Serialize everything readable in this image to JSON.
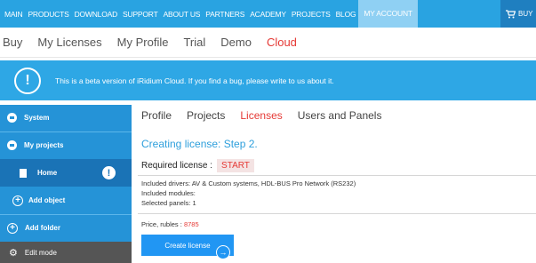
{
  "topnav": {
    "items": [
      "MAIN",
      "PRODUCTS",
      "DOWNLOAD",
      "SUPPORT",
      "ABOUT US",
      "PARTNERS",
      "ACADEMY",
      "PROJECTS",
      "BLOG"
    ],
    "active_item": "MY ACCOUNT",
    "cart_label": "BUY"
  },
  "subnav": {
    "items": [
      "Buy",
      "My Licenses",
      "My Profile",
      "Trial",
      "Demo"
    ],
    "active_item": "Cloud"
  },
  "banner": {
    "icon_text": "!",
    "text": "This is a beta version of iRidium Cloud. If you find a bug, please write to us about it."
  },
  "sidebar": {
    "system": "System",
    "my_projects": "My projects",
    "home": "Home",
    "home_warning": "!",
    "add_object": "Add object",
    "add_folder": "Add folder",
    "edit_mode": "Edit mode"
  },
  "tabs": {
    "items": [
      "Profile",
      "Projects"
    ],
    "active_item": "Licenses",
    "last_item": "Users and Panels"
  },
  "main": {
    "step_title": "Creating license: Step 2.",
    "required_label": "Required license :",
    "required_value": "START",
    "drivers_line": "Included drivers: AV & Custom systems, HDL-BUS Pro Network (RS232)",
    "modules_line": "Included modules:",
    "panels_line": "Selected panels: 1",
    "price_label": "Price, rubles :",
    "price_value": "8785",
    "create_button": "Create license"
  },
  "colors": {
    "brand_blue": "#29a3e1",
    "accent_red": "#e53935",
    "sidebar_blue": "#2593d7"
  }
}
